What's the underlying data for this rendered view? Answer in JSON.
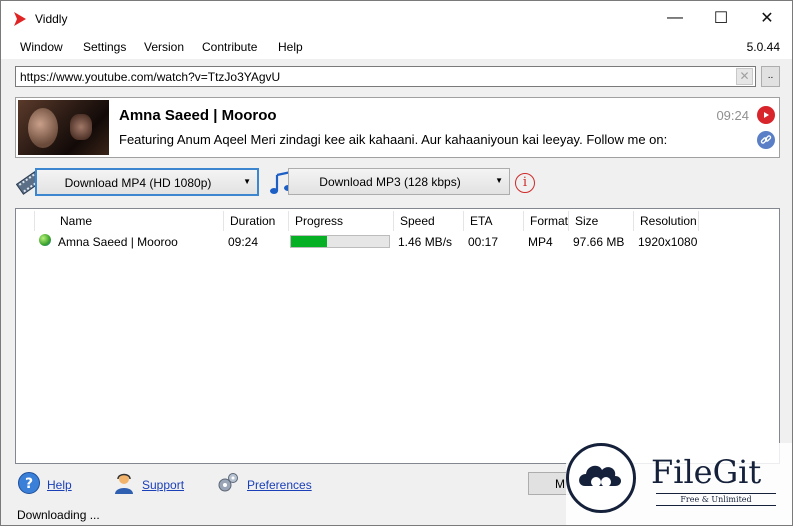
{
  "window": {
    "title": "Viddly",
    "controls": {
      "minimize": "—",
      "maximize": "☐",
      "close": "✕"
    }
  },
  "menu": {
    "items": [
      "Window",
      "Settings",
      "Version",
      "Contribute",
      "Help"
    ],
    "version": "5.0.44"
  },
  "url": {
    "value": "https://www.youtube.com/watch?v=TtzJo3YAgvU",
    "clear_glyph": "✕",
    "more_label": ".."
  },
  "video": {
    "title": "Amna Saeed | Mooroo",
    "description": "Featuring Anum Aqeel Meri zindagi kee aik kahaani. Aur kahaaniyoun kai leeyay. Follow me on:",
    "duration": "09:24"
  },
  "download": {
    "video_option": "Download MP4 (HD 1080p)",
    "audio_option": "Download MP3 (128 kbps)",
    "info_glyph": "i"
  },
  "table": {
    "columns": [
      "Name",
      "Duration",
      "Progress",
      "Speed",
      "ETA",
      "Format",
      "Size",
      "Resolution"
    ],
    "rows": [
      {
        "name": "Amna Saeed | Mooroo",
        "duration": "09:24",
        "progress_fraction": 0.37,
        "speed": "1.46 MB/s",
        "eta": "00:17",
        "format": "MP4",
        "size": "97.66 MB",
        "resolution": "1920x1080"
      }
    ]
  },
  "footer": {
    "help": "Help",
    "support": "Support",
    "preferences": "Preferences",
    "button_partial": "M",
    "status": "Downloading ..."
  },
  "watermark": {
    "brand": "FileGit",
    "tagline": "Free & Unlimited"
  },
  "colors": {
    "accent": "#3c86d0",
    "progress": "#06b025",
    "youtube": "#d8242b",
    "link": "#1a3fb8"
  }
}
